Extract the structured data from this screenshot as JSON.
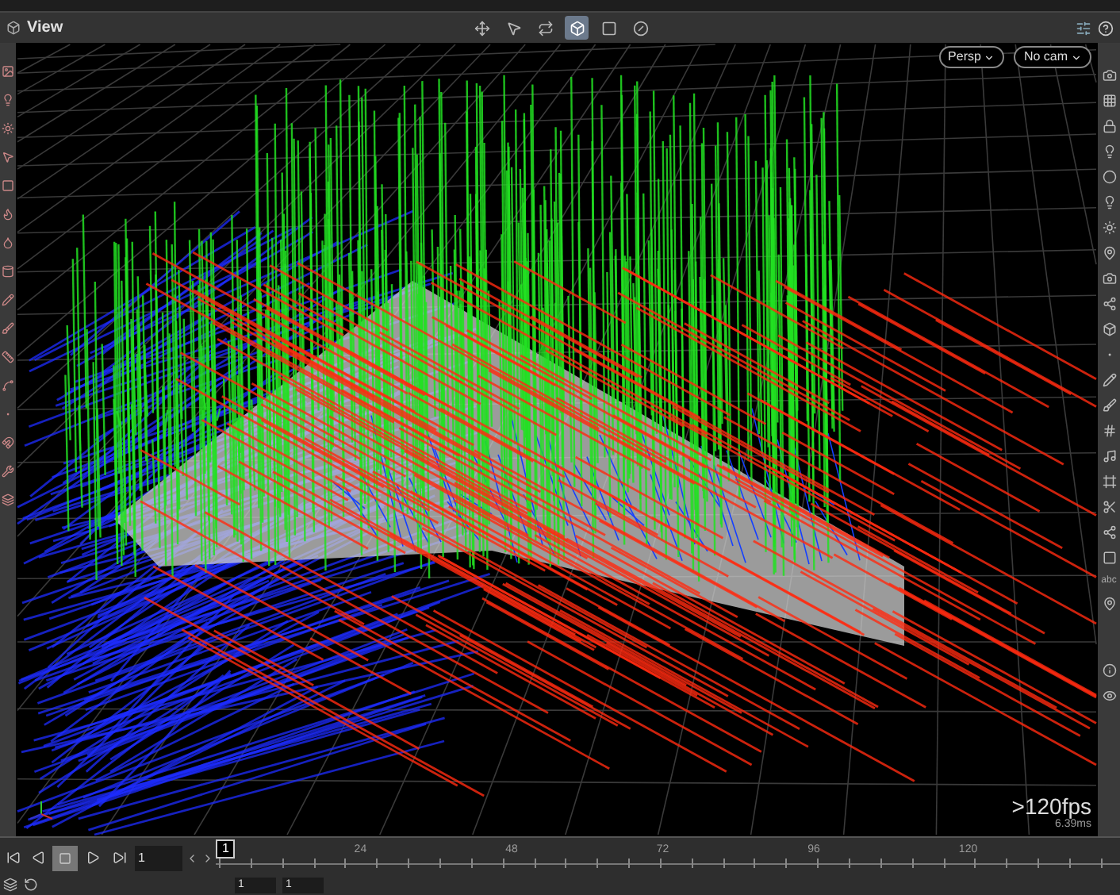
{
  "panel": {
    "title": "View"
  },
  "view_tools": [
    {
      "selected": false
    },
    {
      "selected": false
    },
    {
      "selected": false
    },
    {
      "selected": true
    },
    {
      "selected": false
    },
    {
      "selected": false
    }
  ],
  "viewport": {
    "camera_menus": [
      {
        "label": "Persp"
      },
      {
        "label": "No cam"
      }
    ],
    "fps": ">120fps",
    "frame_time": "6.39ms"
  },
  "right_toolbar": {
    "text_tool": "abc"
  },
  "playback": {
    "frame": "1",
    "marker": "1",
    "ticks": [
      "24",
      "48",
      "72",
      "96",
      "120"
    ]
  },
  "range": {
    "start": "1",
    "end": "1"
  }
}
